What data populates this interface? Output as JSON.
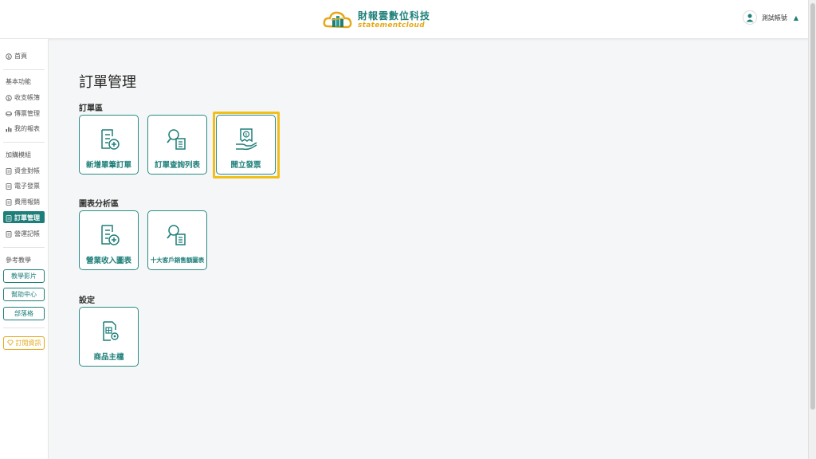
{
  "header": {
    "brand_cn": "財報雲數位科技",
    "brand_en": "statementcloud",
    "account_name": "測試帳號"
  },
  "sidebar": {
    "home": "首頁",
    "basic_heading": "基本功能",
    "basic_items": [
      "收支帳簿",
      "傳票管理",
      "我的報表"
    ],
    "addon_heading": "加購模組",
    "addon_items": [
      "資金對帳",
      "電子發票",
      "費用報銷",
      "訂單管理",
      "營運記帳"
    ],
    "active_item": "訂單管理",
    "learn_heading": "參考教學",
    "learn_buttons": [
      "教學影片",
      "幫助中心",
      "部落格"
    ],
    "subscription_button": "訂閱資訊"
  },
  "main": {
    "title": "訂單管理",
    "sections": [
      {
        "title": "訂單區",
        "cards": [
          {
            "label": "新增單筆訂單",
            "icon": "add-document-icon"
          },
          {
            "label": "訂單查詢列表",
            "icon": "search-document-icon"
          },
          {
            "label": "開立發票",
            "icon": "invoice-hand-icon",
            "highlighted": true
          }
        ]
      },
      {
        "title": "圖表分析區",
        "cards": [
          {
            "label": "營業收入圖表",
            "icon": "add-document-icon"
          },
          {
            "label": "十大客戶銷售額圖表",
            "icon": "search-document-icon"
          }
        ]
      },
      {
        "title": "設定",
        "cards": [
          {
            "label": "商品主檔",
            "icon": "product-settings-icon"
          }
        ]
      }
    ]
  },
  "colors": {
    "brand_teal": "#1e7f7a",
    "brand_gold": "#e6a818",
    "highlight": "#f2bf1a"
  }
}
